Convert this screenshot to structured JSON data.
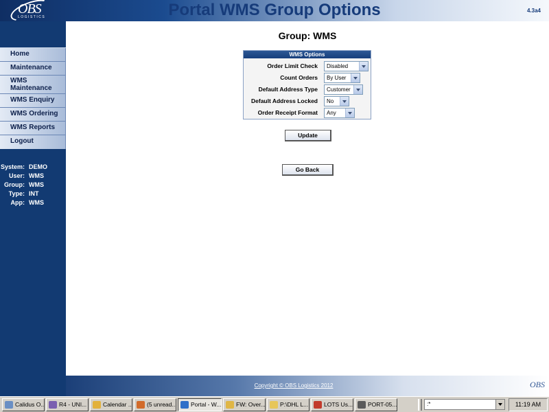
{
  "header": {
    "logo_text": "OBS",
    "logo_subtext": "LOGISTICS",
    "title": "Portal WMS Group Options",
    "version": "4.3a4"
  },
  "sidebar": {
    "items": [
      {
        "label": "Home"
      },
      {
        "label": "Maintenance"
      },
      {
        "label": "WMS Maintenance"
      },
      {
        "label": "WMS Enquiry"
      },
      {
        "label": "WMS Ordering"
      },
      {
        "label": "WMS Reports"
      },
      {
        "label": "Logout"
      }
    ],
    "info": [
      {
        "key": "System:",
        "value": "DEMO"
      },
      {
        "key": "User:",
        "value": "WMS"
      },
      {
        "key": "Group:",
        "value": "WMS"
      },
      {
        "key": "Type:",
        "value": "INT"
      },
      {
        "key": "App:",
        "value": "WMS"
      }
    ]
  },
  "main": {
    "heading": "Group: WMS",
    "options_title": "WMS Options",
    "options": [
      {
        "label": "Order Limit Check",
        "value": "Disabled"
      },
      {
        "label": "Count Orders",
        "value": "By User"
      },
      {
        "label": "Default Address Type",
        "value": "Customer"
      },
      {
        "label": "Default Address Locked",
        "value": "No"
      },
      {
        "label": "Order Receipt Format",
        "value": "Any"
      }
    ],
    "update_label": "Update",
    "goback_label": "Go Back"
  },
  "footer": {
    "copyright": "Copyright © OBS Logistics 2012",
    "logo_text": "OBS"
  },
  "taskbar": {
    "tasks": [
      {
        "label": "Calidus O...",
        "icon": "calidus-icon",
        "color": "#6a8fc4"
      },
      {
        "label": "R4 - UNI...",
        "icon": "app-icon",
        "color": "#7a5fb0"
      },
      {
        "label": "Calendar ...",
        "icon": "calendar-icon",
        "color": "#e2b13c"
      },
      {
        "label": "(5 unread...",
        "icon": "mail-icon",
        "color": "#d26b2a"
      },
      {
        "label": "Portal - W...",
        "icon": "ie-icon",
        "color": "#2f6fc8"
      },
      {
        "label": "FW: Over...",
        "icon": "email-icon",
        "color": "#e0b645"
      },
      {
        "label": "P:\\DHL L...",
        "icon": "folder-icon",
        "color": "#e7c65a"
      },
      {
        "label": "LOTS Us...",
        "icon": "pdf-icon",
        "color": "#c23a2b"
      },
      {
        "label": "PORT-05...",
        "icon": "window-icon",
        "color": "#5a5a5a"
      }
    ],
    "address_value": ":*",
    "clock": "11:19 AM"
  }
}
